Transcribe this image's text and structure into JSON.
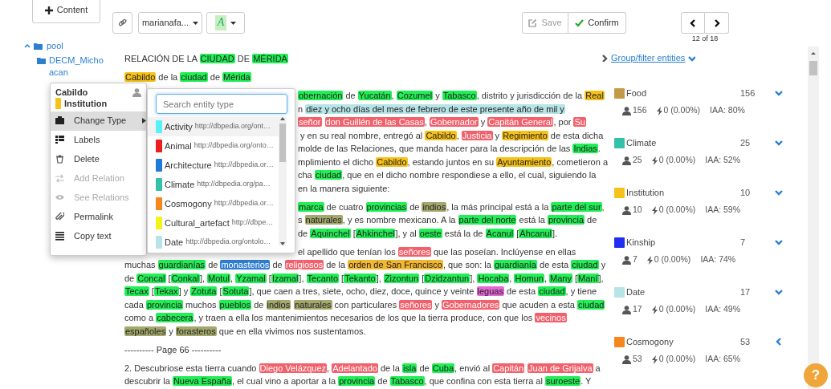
{
  "toolbar": {
    "content_button": "Content",
    "user_menu": "marianafa...",
    "style_button": "A",
    "save_button": {
      "label": "Save",
      "disabled": true
    },
    "confirm_button": "Confirm",
    "page_counter": "12 of 18"
  },
  "tree": [
    {
      "label": "pool",
      "expanded": true,
      "children": [
        {
          "label": "DECM_Michoacan"
        }
      ]
    }
  ],
  "document": {
    "paragraphs": [
      {
        "lines": [
          {
            "clipped": false,
            "segments": [
              {
                "text": "RELACIÓN DE LA "
              },
              {
                "text": "CIUDAD",
                "color": "#22ee55"
              },
              {
                "text": " DE "
              },
              {
                "text": "MÉRIDA",
                "color": "#22ee55"
              }
            ]
          }
        ]
      },
      {
        "lines": [
          {
            "clipped": false,
            "segments": [
              {
                "text": "Cabildo",
                "color": "#f6c21a"
              },
              {
                "text": " de la "
              },
              {
                "text": "ciudad",
                "color": "#22ee55"
              },
              {
                "text": " de "
              },
              {
                "text": "Mérida",
                "color": "#22ee55"
              }
            ]
          }
        ]
      },
      {
        "lines": [
          {
            "clipped": true,
            "segments": [
              {
                "text": "obernación",
                "color": "#22ee55"
              },
              {
                "text": " de "
              },
              {
                "text": "Yucatán",
                "color": "#22ee55"
              },
              {
                "text": ", "
              },
              {
                "text": "Cozumel",
                "color": "#22ee55"
              },
              {
                "text": " y "
              },
              {
                "text": "Tabasco",
                "color": "#22ee55"
              },
              {
                "text": ", distrito y jurisdicción de la "
              },
              {
                "text": "Real",
                "color": "#f6c21a"
              }
            ]
          },
          {
            "clipped": true,
            "segments": [
              {
                "text": "n "
              },
              {
                "text": "diez y ocho días del mes de febrero de este presente año de mil y",
                "color": "#b7e4e6"
              }
            ]
          },
          {
            "clipped": true,
            "segments": [
              {
                "text": "señor",
                "color": "#f2606b"
              },
              {
                "text": "don Guillén de las Casas",
                "color": "#f2606b"
              },
              {
                "text": ", "
              },
              {
                "text": "Gobernador",
                "color": "#f2606b"
              },
              {
                "text": " y "
              },
              {
                "text": "Capitán General",
                "color": "#f2606b"
              },
              {
                "text": ", por "
              },
              {
                "text": "Su",
                "color": "#f2606b"
              }
            ]
          },
          {
            "clipped": true,
            "segments": [
              {
                "text": " y en su real nombre, entregó al "
              },
              {
                "text": "Cabildo",
                "color": "#f6c21a"
              },
              {
                "text": ", "
              },
              {
                "text": "Justicia",
                "color": "#f2606b"
              },
              {
                "text": " y "
              },
              {
                "text": "Regimiento",
                "color": "#f6c21a"
              },
              {
                "text": " de esta dicha"
              }
            ]
          },
          {
            "clipped": true,
            "segments": [
              {
                "text": "molde de las Relaciones, que manda hacer para la descripción de las "
              },
              {
                "text": "Indias",
                "color": "#22ee55"
              },
              {
                "text": "."
              }
            ]
          },
          {
            "clipped": true,
            "segments": [
              {
                "text": "mplimiento el dicho "
              },
              {
                "text": "Cabildo",
                "color": "#f6c21a"
              },
              {
                "text": ", estando juntos en su "
              },
              {
                "text": "Ayuntamiento",
                "color": "#f6c21a"
              },
              {
                "text": ", cometieron a"
              }
            ]
          },
          {
            "clipped": true,
            "segments": [
              {
                "text": "cha "
              },
              {
                "text": "ciudad",
                "color": "#22ee55"
              },
              {
                "text": ", que en el dicho nombre respondiese a ello, el cual, siguiendo la"
              }
            ]
          },
          {
            "clipped": true,
            "segments": [
              {
                "text": "en la manera siguiente:"
              }
            ]
          }
        ]
      },
      {
        "lines": [
          {
            "clipped": true,
            "segments": [
              {
                "text": "marca",
                "color": "#22ee55"
              },
              {
                "text": " de cuatro "
              },
              {
                "text": "provincias",
                "color": "#22ee55"
              },
              {
                "text": " de "
              },
              {
                "text": "indios",
                "color": "#a3a86c"
              },
              {
                "text": ", la más principal está a la "
              },
              {
                "text": "parte del sur",
                "color": "#22ee55"
              },
              {
                "text": ","
              }
            ]
          },
          {
            "clipped": true,
            "segments": [
              {
                "text": "s "
              },
              {
                "text": "naturales",
                "color": "#a3a86c"
              },
              {
                "text": ", y es nombre mexicano. A la "
              },
              {
                "text": "parte del norte",
                "color": "#22ee55"
              },
              {
                "text": " está la "
              },
              {
                "text": "provincia",
                "color": "#22ee55"
              },
              {
                "text": " de"
              }
            ]
          },
          {
            "clipped": true,
            "segments": [
              {
                "text": "de "
              },
              {
                "text": "Aquinchel",
                "color": "#22ee55"
              },
              {
                "text": " ["
              },
              {
                "text": "Ahkinchel",
                "color": "#22ee55"
              },
              {
                "text": "], y al "
              },
              {
                "text": "oeste",
                "color": "#22ee55"
              },
              {
                "text": " está la de "
              },
              {
                "text": "Acanul",
                "color": "#22ee55"
              },
              {
                "text": " ["
              },
              {
                "text": "Ahcanul",
                "color": "#22ee55"
              },
              {
                "text": "]."
              }
            ]
          }
        ]
      },
      {
        "lines": [
          {
            "clipped": true,
            "segments": [
              {
                "text": "el apellido que tenían los "
              },
              {
                "text": "señores",
                "color": "#f2606b"
              },
              {
                "text": " que las poseían. Inclúyense en ellas"
              }
            ]
          },
          {
            "clipped": false,
            "segments": [
              {
                "text": "muchas "
              },
              {
                "text": "guardianías",
                "color": "#22ee55"
              },
              {
                "text": " de "
              },
              {
                "text": "monasterios",
                "color": "#2d7dd2"
              },
              {
                "text": " de "
              },
              {
                "text": "religiosos",
                "color": "#f2606b"
              },
              {
                "text": " de la "
              },
              {
                "text": "orden de San Francisco",
                "color": "#f3b72f"
              },
              {
                "text": ", que son: la "
              },
              {
                "text": "guardianía",
                "color": "#22ee55"
              },
              {
                "text": " de esta "
              },
              {
                "text": "ciudad",
                "color": "#22ee55"
              },
              {
                "text": " y"
              }
            ]
          },
          {
            "clipped": false,
            "segments": [
              {
                "text": "de "
              },
              {
                "text": "Concal",
                "color": "#22ee55"
              },
              {
                "text": " ["
              },
              {
                "text": "Conkal",
                "color": "#22ee55"
              },
              {
                "text": "], "
              },
              {
                "text": "Motul",
                "color": "#22ee55"
              },
              {
                "text": ", "
              },
              {
                "text": "Yzamal",
                "color": "#22ee55"
              },
              {
                "text": " ["
              },
              {
                "text": "Izamal",
                "color": "#22ee55"
              },
              {
                "text": "], "
              },
              {
                "text": "Tecanto",
                "color": "#22ee55"
              },
              {
                "text": " ["
              },
              {
                "text": "Tekanto",
                "color": "#22ee55"
              },
              {
                "text": "], "
              },
              {
                "text": "Zizontun",
                "color": "#22ee55"
              },
              {
                "text": " ["
              },
              {
                "text": "Dzidzantun",
                "color": "#22ee55"
              },
              {
                "text": "], "
              },
              {
                "text": "Hocaba",
                "color": "#22ee55"
              },
              {
                "text": ", "
              },
              {
                "text": "Homun",
                "color": "#22ee55"
              },
              {
                "text": ", "
              },
              {
                "text": "Many",
                "color": "#22ee55"
              },
              {
                "text": " ["
              },
              {
                "text": "Maní",
                "color": "#22ee55"
              },
              {
                "text": "],"
              }
            ]
          },
          {
            "clipped": false,
            "segments": [
              {
                "text": "Tecax",
                "color": "#22ee55"
              },
              {
                "text": " ["
              },
              {
                "text": "Tekax",
                "color": "#22ee55"
              },
              {
                "text": "] y "
              },
              {
                "text": "Zotuta",
                "color": "#22ee55"
              },
              {
                "text": " ["
              },
              {
                "text": "Sotuta",
                "color": "#22ee55"
              },
              {
                "text": "], que caen a tres, siete, ocho, diez, doce, quince y veinte "
              },
              {
                "text": "leguas",
                "color": "#e467d6"
              },
              {
                "text": " de esta "
              },
              {
                "text": "ciudad",
                "color": "#22ee55"
              },
              {
                "text": ", y tiene"
              }
            ]
          },
          {
            "clipped": false,
            "segments": [
              {
                "text": "cada "
              },
              {
                "text": "provincia",
                "color": "#22ee55"
              },
              {
                "text": " muchos "
              },
              {
                "text": "pueblos",
                "color": "#22ee55"
              },
              {
                "text": " de "
              },
              {
                "text": "indios",
                "color": "#a3a86c"
              },
              {
                "text": "naturales",
                "color": "#a3a86c"
              },
              {
                "text": " con particulares "
              },
              {
                "text": "señores",
                "color": "#f2606b"
              },
              {
                "text": " y "
              },
              {
                "text": "Gobernadores",
                "color": "#f2606b"
              },
              {
                "text": " que acuden a esta "
              },
              {
                "text": "ciudad",
                "color": "#22ee55"
              }
            ]
          },
          {
            "clipped": false,
            "segments": [
              {
                "text": "como a "
              },
              {
                "text": "cabecera",
                "color": "#22ee55"
              },
              {
                "text": ", y traen a ella los mantenimientos necesarios de los que la tierra produce, con que los "
              },
              {
                "text": "vecinos",
                "color": "#f2606b"
              }
            ]
          },
          {
            "clipped": false,
            "segments": [
              {
                "text": "españoles",
                "color": "#a3a86c"
              },
              {
                "text": " y "
              },
              {
                "text": "forasteros",
                "color": "#a3a86c"
              },
              {
                "text": " que en ella vivimos nos sustentamos."
              }
            ]
          }
        ]
      },
      {
        "lines": [
          {
            "clipped": false,
            "segments": [
              {
                "text": "---------- Page 66 ----------"
              }
            ]
          }
        ]
      },
      {
        "lines": [
          {
            "clipped": false,
            "segments": [
              {
                "text": "2. Descubriose esta tierra cuando "
              },
              {
                "text": "Diego Velázquez",
                "color": "#f2606b"
              },
              {
                "text": ", "
              },
              {
                "text": "Adelantado",
                "color": "#f2606b"
              },
              {
                "text": " de la "
              },
              {
                "text": "isla",
                "color": "#22ee55"
              },
              {
                "text": " de "
              },
              {
                "text": "Cuba",
                "color": "#22ee55"
              },
              {
                "text": ", envió al "
              },
              {
                "text": "Capitán",
                "color": "#f2606b"
              },
              {
                "text": "Juan de Grijalva",
                "color": "#f2606b"
              },
              {
                "text": " a"
              }
            ]
          },
          {
            "clipped": false,
            "segments": [
              {
                "text": "descubrir la "
              },
              {
                "text": "Nueva España",
                "color": "#22ee55"
              },
              {
                "text": ", el cual vino a aportar a la "
              },
              {
                "text": "provincia",
                "color": "#22ee55"
              },
              {
                "text": " de "
              },
              {
                "text": "Tabasco",
                "color": "#22ee55"
              },
              {
                "text": ", que confina con esta tierra al "
              },
              {
                "text": "suroeste",
                "color": "#22ee55"
              },
              {
                "text": ". Y"
              }
            ]
          }
        ]
      }
    ]
  },
  "entity_panel": {
    "title": "Group/filter entities",
    "entities": [
      {
        "name": "Food",
        "color": "#c49a48",
        "count": "156",
        "annotators": "156",
        "conflicts": "0 (0.00%)",
        "iaa": "IAA: 80%",
        "expanded": true
      },
      {
        "name": "Climate",
        "color": "#33c1a9",
        "count": "25",
        "annotators": "25",
        "conflicts": "0 (0.00%)",
        "iaa": "IAA: 52%",
        "expanded": true
      },
      {
        "name": "Institution",
        "color": "#f6c21a",
        "count": "10",
        "annotators": "10",
        "conflicts": "0 (0.00%)",
        "iaa": "IAA: 59%",
        "expanded": true
      },
      {
        "name": "Kinship",
        "color": "#1f2ef0",
        "count": "7",
        "annotators": "7",
        "conflicts": "0 (0.00%)",
        "iaa": "IAA: 74%",
        "expanded": true
      },
      {
        "name": "Date",
        "color": "#b7e4e6",
        "count": "17",
        "annotators": "17",
        "conflicts": "0 (0.00%)",
        "iaa": "IAA: 49%",
        "expanded": true
      },
      {
        "name": "Cosmogony",
        "color": "#f7861c",
        "count": "53",
        "annotators": "53",
        "conflicts": "0 (0.00%)",
        "iaa": "IAA: 65%",
        "expanded": false
      }
    ]
  },
  "context_menu": {
    "entity": "Cabildo",
    "type": {
      "name": "Institution",
      "color": "#f6c21a"
    },
    "items": [
      {
        "label": "Change Type",
        "selected": true,
        "disabled": false,
        "submenu": true
      },
      {
        "label": "Labels",
        "selected": false,
        "disabled": false,
        "submenu": false
      },
      {
        "label": "Delete",
        "selected": false,
        "disabled": false,
        "submenu": false
      },
      {
        "label": "Add Relation",
        "selected": false,
        "disabled": true,
        "submenu": false
      },
      {
        "label": "See Relations",
        "selected": false,
        "disabled": true,
        "submenu": false
      },
      {
        "label": "Permalink",
        "selected": false,
        "disabled": false,
        "submenu": false
      },
      {
        "label": "Copy text",
        "selected": false,
        "disabled": false,
        "submenu": false
      }
    ]
  },
  "type_submenu": {
    "placeholder": "Search entity type",
    "types": [
      {
        "name": "Activity",
        "url": "http://dbpedia.org/ont…",
        "color": "#56f2f6",
        "selected": true
      },
      {
        "name": "Animal",
        "url": "http://dbpedia.org/onto…",
        "color": "#f01d1d",
        "selected": false
      },
      {
        "name": "Architecture",
        "url": "http://dbpedia.or…",
        "color": "#1f7bd6",
        "selected": false
      },
      {
        "name": "Climate",
        "url": "http://dbpedia.org/pa…",
        "color": "#33c1a9",
        "selected": false
      },
      {
        "name": "Cosmogony",
        "url": "http://dbpedia.or…",
        "color": "#f7861c",
        "selected": false
      },
      {
        "name": "Cultural_artefact",
        "url": "http://dbpe…",
        "color": "#f2f21d",
        "selected": false
      },
      {
        "name": "Date",
        "url": "http://dbpedia.org/ontolo…",
        "color": "#b7e4e6",
        "selected": false
      }
    ]
  },
  "help_button": "?"
}
